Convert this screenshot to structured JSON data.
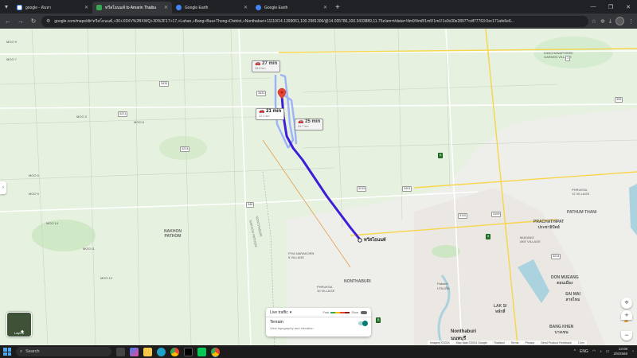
{
  "browser": {
    "tabs": [
      {
        "label": "google - ค้นหา",
        "active": false,
        "icon": "google-icon"
      },
      {
        "label": "ทวีสโธนนท์ to Amarin Thaibu",
        "active": true,
        "icon": "maps-icon"
      },
      {
        "label": "Google Earth",
        "active": false,
        "icon": "earth-icon"
      },
      {
        "label": "Google Earth",
        "active": false,
        "icon": "earth-icon"
      }
    ],
    "new_tab": "+",
    "url": "google.com/maps/dir/ทวีสโธนนท์,+30+X9XV%2BXWQ+30%2F17+17,+Lahan,+Bang+Bua+Thong+District,+Nonthaburi+11110/14.1399061,100.2981306/@14.035786,100.3433889,11.75z/am=t/data=!4m9!4m8!1m5!1m1!1s0x30e2897?cdf77763:0xc171afe6e6..."
  },
  "map": {
    "routes": [
      {
        "time": "27 min",
        "distance": "28.8 km",
        "type": "alt"
      },
      {
        "time": "21 min",
        "distance": "22.2 km",
        "type": "main"
      },
      {
        "time": "25 min",
        "distance": "24.7 km",
        "type": "alt"
      }
    ],
    "destination": "ทวีสโธนนท์",
    "labels": {
      "moo9a": "MOO 9",
      "moo7a": "MOO 7",
      "moo6": "MOO 6",
      "moo9b": "MOO 9",
      "moo9c": "MOO 9",
      "moo14": "MOO 14",
      "moo11": "MOO 11",
      "moo12": "MOO 12",
      "moo3": "MOO 3",
      "nakhon_pathom": "NAKHON\nPATHOM",
      "nonthaburi_boundary": "NONTHABURI",
      "nakhon_pathom_boundary": "NAKHON PATHOM",
      "nonthaburi": "NONTHABURI",
      "pathum_thani": "PATHUM THANI",
      "prachathipat": "PRACHATHIPAT\nประชาธิปัตย์",
      "don_mueang": "DON MUEANG\nดอนเมือง",
      "sai_mai": "SAI MAI\nสายไหม",
      "lak_si": "LAK SI\nหลักสี่",
      "bang_khen": "BANG KHEN\nบางเขน",
      "nonthaburi_city": "Nonthaburi\nนนทบุรี",
      "pakkret": "Pakkret\nปากเกร็ด",
      "phruksa12": "PHRUKSA\n12 VILLAGE",
      "mueang_ake": "MUEANG\nAKE VILLAGE",
      "piya_narakorn": "PIYA NARAKORN\n5 VILLAGE",
      "phruksa10": "PHRUKSA\n10 VILLAGE",
      "kanchanaphisek": "KANCHANAPHISEK\nGARDEN VILLAGE"
    },
    "layers_label": "Layers",
    "traffic": {
      "title": "Live traffic",
      "fast": "Fast",
      "slow": "Slow",
      "colors": [
        "#34a853",
        "#fbbc04",
        "#ea4335",
        "#8b1a10"
      ]
    },
    "terrain": {
      "title": "Terrain",
      "subtitle": "View topography and elevation"
    },
    "footer": [
      "Imagery ©2024",
      "Map data ©2024 Google",
      "Thailand",
      "Terms",
      "Privacy",
      "Send Product Feedback",
      "2 km"
    ],
    "route_color": "#3c1fd6"
  },
  "taskbar": {
    "search_placeholder": "Search",
    "lang": "ENG",
    "time": "13:08",
    "date": "2/8/2569"
  }
}
